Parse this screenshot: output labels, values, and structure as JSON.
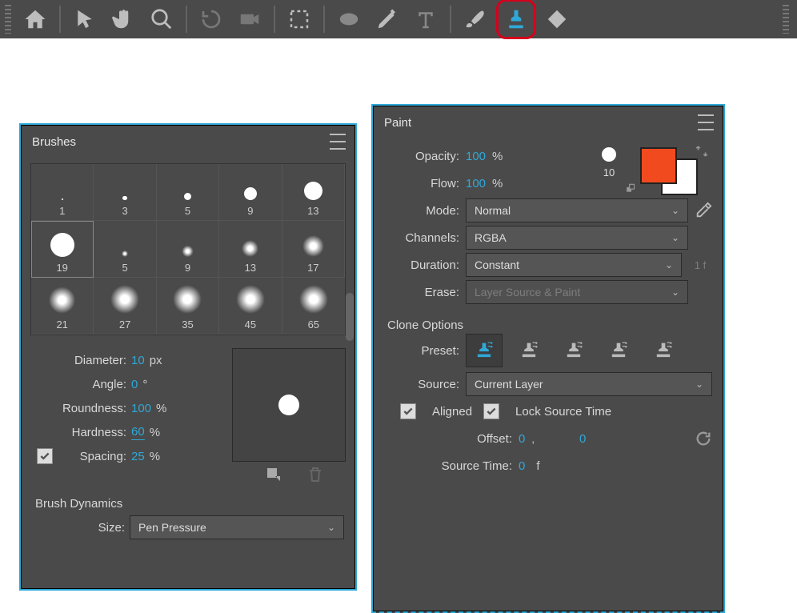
{
  "toolbar": {
    "tools": [
      "home",
      "pointer",
      "hand",
      "zoom",
      "rotate",
      "camera",
      "region",
      "ellipse",
      "pen",
      "type",
      "brush",
      "clone-stamp",
      "eraser"
    ]
  },
  "brushes_panel": {
    "title": "Brushes",
    "grid": [
      {
        "size": 1
      },
      {
        "size": 3
      },
      {
        "size": 5
      },
      {
        "size": 9
      },
      {
        "size": 13
      },
      {
        "size": 19,
        "selected": true
      },
      {
        "size": 5,
        "soft": true
      },
      {
        "size": 9,
        "soft": true
      },
      {
        "size": 13,
        "soft": true
      },
      {
        "size": 17,
        "soft": true
      },
      {
        "size": 21,
        "soft": true
      },
      {
        "size": 27,
        "soft": true
      },
      {
        "size": 35,
        "soft": true
      },
      {
        "size": 45,
        "soft": true
      },
      {
        "size": 65,
        "soft": true
      }
    ],
    "props": {
      "diameter_label": "Diameter:",
      "diameter_value": "10",
      "diameter_unit": "px",
      "angle_label": "Angle:",
      "angle_value": "0",
      "angle_unit": "°",
      "roundness_label": "Roundness:",
      "roundness_value": "100",
      "roundness_unit": "%",
      "hardness_label": "Hardness:",
      "hardness_value": "60",
      "hardness_unit": "%",
      "spacing_label": "Spacing:",
      "spacing_value": "25",
      "spacing_unit": "%"
    },
    "dynamics_title": "Brush Dynamics",
    "size_label": "Size:",
    "size_select": "Pen Pressure"
  },
  "paint_panel": {
    "title": "Paint",
    "opacity_label": "Opacity:",
    "opacity_value": "100",
    "opacity_unit": "%",
    "flow_label": "Flow:",
    "flow_value": "100",
    "flow_unit": "%",
    "brush_size": "10",
    "mode_label": "Mode:",
    "mode_value": "Normal",
    "channels_label": "Channels:",
    "channels_value": "RGBA",
    "duration_label": "Duration:",
    "duration_value": "Constant",
    "duration_suffix": "1 f",
    "erase_label": "Erase:",
    "erase_value": "Layer Source & Paint",
    "clone_title": "Clone Options",
    "preset_label": "Preset:",
    "source_label": "Source:",
    "source_value": "Current Layer",
    "aligned_label": "Aligned",
    "lock_label": "Lock Source Time",
    "offset_label": "Offset:",
    "offset_x": "0",
    "offset_sep": ",",
    "offset_y": "0",
    "sourcetime_label": "Source Time:",
    "sourcetime_value": "0",
    "sourcetime_unit": "f",
    "colors": {
      "fg": "#f04a1e",
      "bg": "#ffffff"
    }
  }
}
